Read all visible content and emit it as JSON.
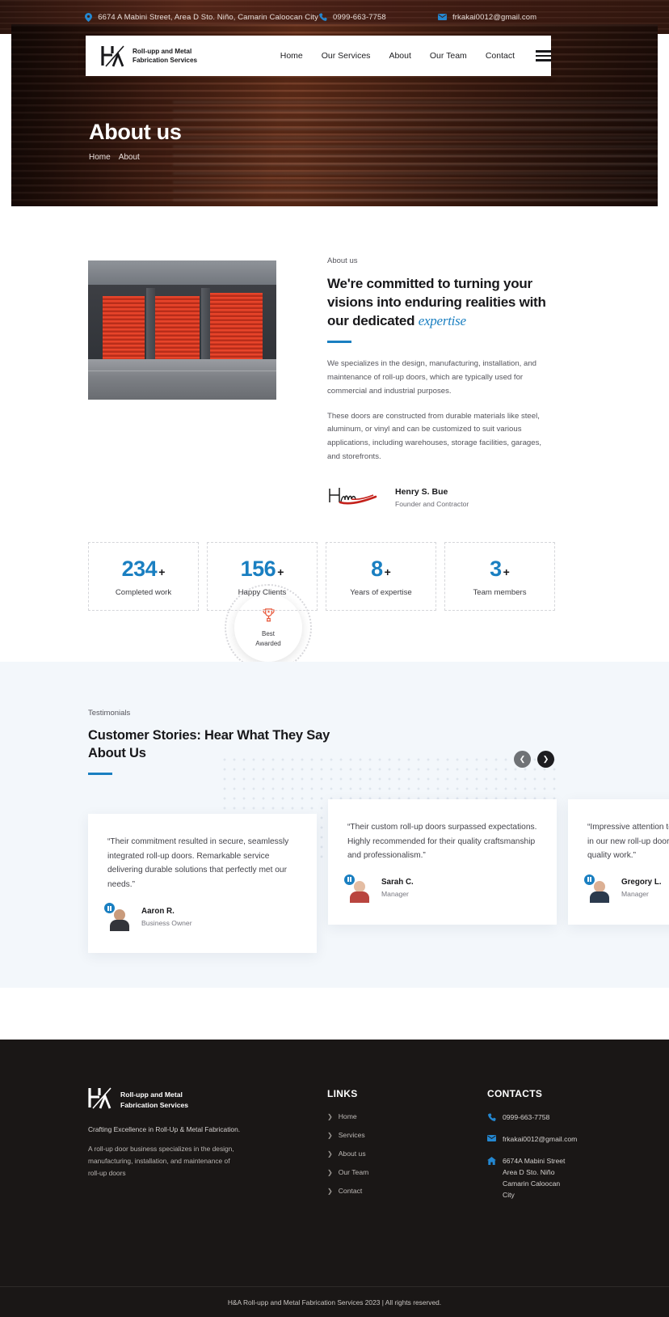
{
  "topbar": {
    "address": "6674 A Mabini Street, Area D Sto. Niño, Camarin Caloocan City",
    "phone": "0999-663-7758",
    "email": "frkakai0012@gmail.com",
    "icon_location": "location-pin-icon",
    "icon_phone": "phone-icon",
    "icon_email": "envelope-icon"
  },
  "header": {
    "brand_line1": "Roll-upp and Metal",
    "brand_line2": "Fabrication Services",
    "logo": "ha-monogram-logo",
    "nav": [
      {
        "label": "Home"
      },
      {
        "label": "Our Services"
      },
      {
        "label": "About"
      },
      {
        "label": "Our Team"
      },
      {
        "label": "Contact"
      }
    ],
    "menu_icon": "hamburger-menu-icon"
  },
  "hero": {
    "title": "About us",
    "breadcrumb": [
      "Home",
      "About"
    ]
  },
  "about": {
    "eyebrow": "About us",
    "heading_part1": "We're committed to turning your visions into enduring realities with our dedicated ",
    "heading_emphasis": "expertise",
    "paragraph1": "We specializes in the design, manufacturing, installation, and maintenance of roll-up doors, which are typically used for commercial and industrial purposes.",
    "paragraph2": "These doors are constructed from durable materials like steel, aluminum, or vinyl and can be customized to suit various applications, including warehouses, storage facilities, garages, and storefronts.",
    "signature_name": "Henry S. Bue",
    "signature_role": "Founder and Contractor",
    "signature_image": "handwritten-signature",
    "badge": {
      "icon": "trophy-icon",
      "line1": "Best",
      "line2": "Awarded",
      "accent_color": "#e8573a"
    },
    "photo_alt": "red-rollup-doors-warehouse-photo",
    "accent_color": "#1a7fc1"
  },
  "stats": [
    {
      "value": "234",
      "suffix": "+",
      "label": "Completed work"
    },
    {
      "value": "156",
      "suffix": "+",
      "label": "Happy Clients"
    },
    {
      "value": "8",
      "suffix": "+",
      "label": "Years of expertise"
    },
    {
      "value": "3",
      "suffix": "+",
      "label": "Team members"
    }
  ],
  "testimonials": {
    "eyebrow": "Testimonials",
    "title": "Customer Stories: Hear What They Say About Us",
    "prev_icon": "chevron-left-icon",
    "next_icon": "chevron-right-icon",
    "cards": [
      {
        "quote": "“Their commitment resulted in secure, seamlessly integrated roll-up doors. Remarkable service delivering durable solutions that perfectly met our needs.”",
        "name": "Aaron R.",
        "role": "Business Owner"
      },
      {
        "quote": "“Their custom roll-up doors surpassed expectations. Highly recommended for their quality craftsmanship and professionalism.”",
        "name": "Sarah C.",
        "role": "Manager"
      },
      {
        "quote": "“Impressive attention to detail and professionalism in our new roll-up doors. Highly recommend their quality work.”",
        "name": "Gregory L.",
        "role": "Manager"
      }
    ]
  },
  "footer": {
    "brand_line1": "Roll-upp and Metal",
    "brand_line2": "Fabrication Services",
    "tagline": "Crafting Excellence in Roll-Up & Metal Fabrication.",
    "description": "A roll-up door business specializes in the design, manufacturing, installation, and maintenance of roll-up doors",
    "links_heading": "LINKS",
    "links": [
      {
        "label": "Home"
      },
      {
        "label": "Services"
      },
      {
        "label": "About us"
      },
      {
        "label": "Our Team"
      },
      {
        "label": "Contact"
      }
    ],
    "contacts_heading": "CONTACTS",
    "contacts": {
      "phone": "0999-663-7758",
      "email": "frkakai0012@gmail.com",
      "address_line1": "6674A Mabini Street",
      "address_line2": "Area D Sto. Niño",
      "address_line3": "Camarin Caloocan",
      "address_line4": "City"
    },
    "copyright": "H&A Roll-upp and Metal Fabrication Services 2023 | All rights reserved."
  }
}
